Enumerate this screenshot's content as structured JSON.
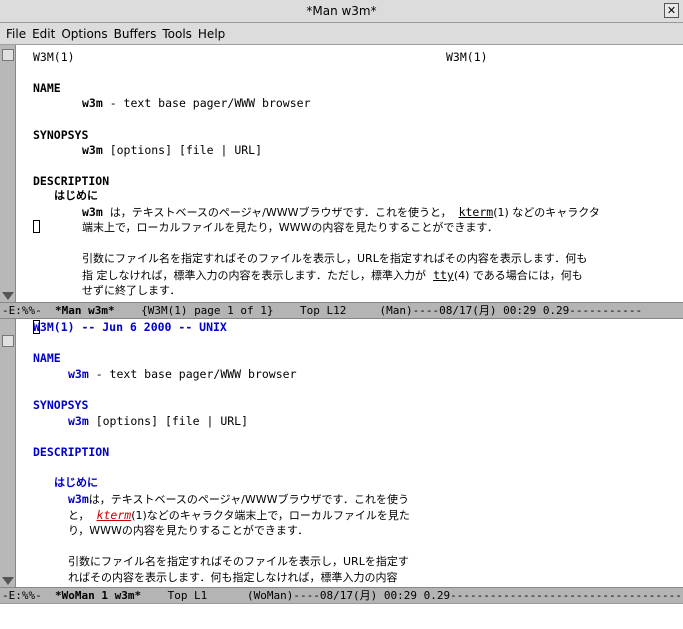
{
  "window": {
    "title": "*Man w3m*"
  },
  "menu": [
    "File",
    "Edit",
    "Options",
    "Buffers",
    "Tools",
    "Help"
  ],
  "top_pane": {
    "header_left": "W3M(1)",
    "header_right": "W3M(1)",
    "name_heading": "NAME",
    "name_cmd": "w3m",
    "name_desc": " - text base pager/WWW browser",
    "synopsis_heading": "SYNOPSYS",
    "synopsis_cmd": "w3m",
    "synopsis_args": " [options] [file | URL]",
    "description_heading": "DESCRIPTION",
    "intro_heading": "はじめに",
    "p1_cmd": "w3m",
    "p1_a": "  は，テキストベースのページャ/WWWブラウザです．これを使うと，  ",
    "p1_link": "kterm",
    "p1_b": "(1) などのキャラクタ",
    "p1_line2": "端末上で，ローカルファイルを見たり，WWWの内容を見たりすることができます．",
    "p2_line1": "引数にファイル名を指定すればそのファイルを表示し，URLを指定すればその内容を表示します．何も",
    "p2_line2a": "指 定しなければ，標準入力の内容を表示します．ただし，標準入力が  ",
    "p2_link": "tty",
    "p2_line2b": "(4) である場合には，何も",
    "p2_line3": "せずに終了します．"
  },
  "top_modeline": {
    "prefix": "-E:%%-  ",
    "buffer": "*Man w3m*",
    "rest": "    {W3M(1) page 1 of 1}    Top L12     (Man)----08/17(月) 00:29 0.29-----------"
  },
  "bottom_pane": {
    "header": "W3M(1) -- Jun 6 2000 -- UNIX",
    "name_heading": "NAME",
    "name_cmd": "w3m",
    "name_desc": " - text base pager/WWW browser",
    "synopsis_heading": "SYNOPSYS",
    "synopsis_cmd": "w3m",
    "synopsis_args": " [options] [file | URL]",
    "description_heading": "DESCRIPTION",
    "intro_heading": "はじめに",
    "p1_cmd": "w3m",
    "p1_line1": "は，テキストベースのページャ/WWWブラウザです．これを使う",
    "p1_line2a": "と，  ",
    "p1_link": "kterm",
    "p1_line2b": "(1)などのキャラクタ端末上で，ローカルファイルを見た",
    "p1_line3": "り，WWWの内容を見たりすることができます．",
    "p2_line1": "引数にファイル名を指定すればそのファイルを表示し，URLを指定す",
    "p2_line2": "ればその内容を表示します．何も指定しなければ，標準入力の内容"
  },
  "bottom_modeline": {
    "prefix": "-E:%%-  ",
    "buffer": "*WoMan 1 w3m*",
    "rest": "    Top L1      (WoMan)----08/17(月) 00:29 0.29------------------------------------"
  }
}
